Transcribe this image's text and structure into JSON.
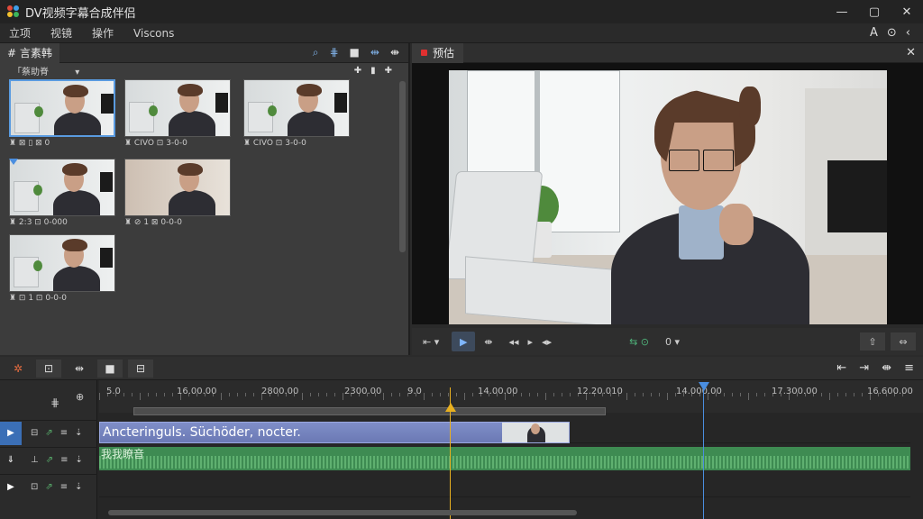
{
  "app": {
    "title": "DV视频字幕合成伴侣"
  },
  "window": {
    "minimize": "—",
    "maximize": "▢",
    "close": "✕"
  },
  "menu": {
    "items": [
      "立项",
      "视镜",
      "操作",
      "Viscons"
    ],
    "tools": [
      "A",
      "⊙",
      "‹"
    ]
  },
  "media_panel": {
    "tab_label": "# 言素韩",
    "tools": [
      "⌕",
      "⋕",
      "■",
      "⇹",
      "⇼"
    ],
    "dropdown": "「蔡助脊",
    "dropdown_caret": "▾",
    "sub_icons": [
      "✚",
      "▮",
      "✚"
    ],
    "clips": [
      {
        "meta": "♜ ⊠ ▯ ⊠ 0",
        "selected": true
      },
      {
        "meta": "♜ CIVO ⊡ 3-0-0",
        "selected": false
      },
      {
        "meta": "♜ CIVO ⊡ 3-0-0",
        "selected": false
      },
      {
        "meta": "♜ 2:3 ⊡ 0-000",
        "selected": false
      },
      {
        "meta": "♜ ⊘ 1 ⊠ 0-0-0",
        "selected": false
      },
      {
        "meta": "♜ ⊡ 1 ⊡ 0-0-0",
        "selected": false
      }
    ]
  },
  "preview": {
    "tab_label": "预估",
    "close": "✕",
    "controls": {
      "left": "⇤ ▾",
      "play": "▶",
      "step": "⇼",
      "rewind": "◂◂",
      "next": "▸",
      "fwd": "◂▸",
      "loop": "⇆ ⊙",
      "time": "0 ▾",
      "snap": "⇧",
      "split": "⇔"
    }
  },
  "timeline": {
    "toolbar": [
      "✲",
      "⊡",
      "⇹",
      "■",
      "⊟"
    ],
    "right_tools": [
      "⇤",
      "⇥",
      "⇼",
      "≡"
    ],
    "head_icons": {
      "snap": "⋕",
      "lock": "⊕"
    },
    "ruler": [
      "5.0",
      "16.00.00",
      "2800.00",
      "2300.00",
      "9.0",
      "14.00.00",
      "12.20.010",
      "14.000.00",
      "17.300.00",
      "16.600.00"
    ],
    "tracks": [
      {
        "toggle": "▶",
        "icons": [
          "⊟",
          "⇗",
          "≡",
          "⇣"
        ],
        "color": "#3b6fb6"
      },
      {
        "toggle": "⇓",
        "icons": [
          "⊥",
          "⇗",
          "≡",
          "⇣"
        ],
        "color": "#2b2b2b"
      },
      {
        "toggle": "▶",
        "icons": [
          "⊡",
          "⇗",
          "≡",
          "⇣"
        ],
        "color": "#2b2b2b"
      }
    ],
    "video_clip_text": "Ancteringuls. Süchöder, nocter.",
    "audio_clip_text": "我我瞭音"
  }
}
